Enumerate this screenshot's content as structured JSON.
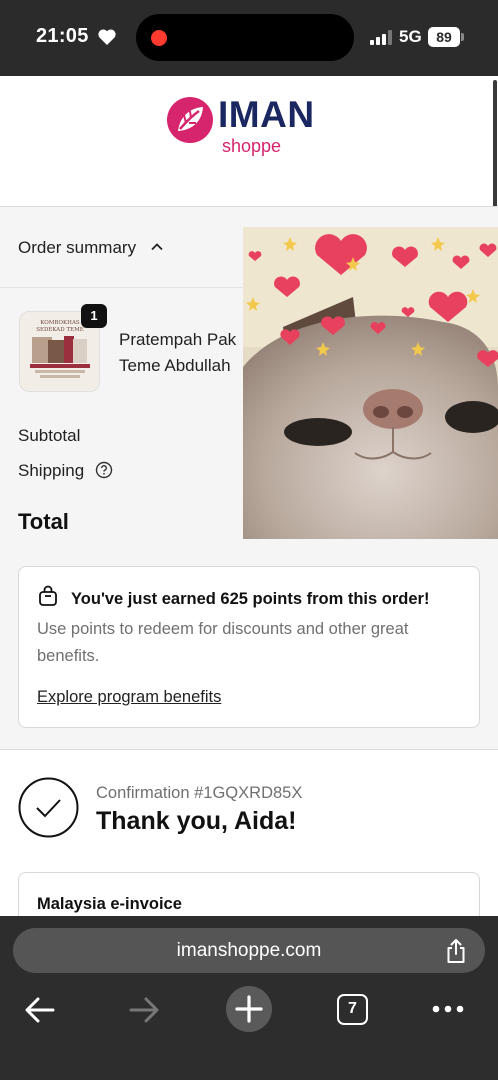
{
  "status_bar": {
    "time": "21:05",
    "network": "5G",
    "battery": "89"
  },
  "brand": {
    "name": "IMAN",
    "sub": "shoppe",
    "primary_color": "#1a2760",
    "accent_color": "#d6246d"
  },
  "order_summary": {
    "toggle_label": "Order summary",
    "item": {
      "quantity": "1",
      "name_line1": "Pratempah Pak",
      "name_line2": "Teme Abdullah",
      "thumbnail_text_1": "KOMBOKHAS",
      "thumbnail_text_2": "SEDEKAD TEME"
    },
    "subtotal_label": "Subtotal",
    "shipping_label": "Shipping",
    "total_label": "Total"
  },
  "points": {
    "title": "You've just earned 625 points from this order!",
    "description": "Use points to redeem for discounts and other great benefits.",
    "link": "Explore program benefits"
  },
  "confirmation": {
    "number": "Confirmation #1GQXRD85X",
    "thank_you": "Thank you, Aida!"
  },
  "invoice": {
    "title": "Malaysia e-invoice"
  },
  "browser": {
    "url": "imanshoppe.com",
    "tab_count": "7"
  },
  "icons": {
    "heart": "heart-icon",
    "help": "question-circle-icon",
    "bag": "shopping-bag-icon",
    "check": "check-circle-icon",
    "share": "share-icon"
  }
}
